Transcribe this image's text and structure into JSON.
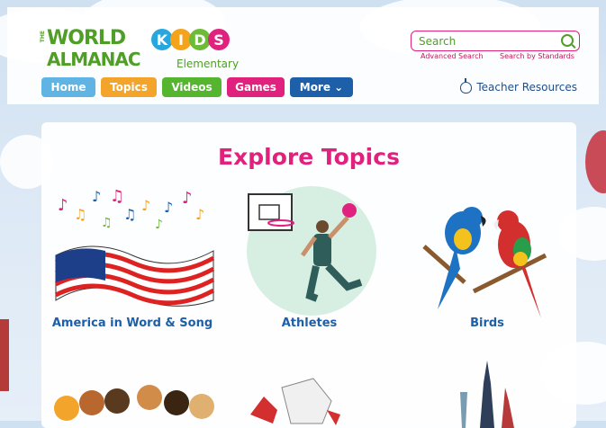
{
  "logo": {
    "the": "THE",
    "world": "WORLD",
    "almanac": "ALMANAC",
    "kids": [
      "K",
      "I",
      "D",
      "S"
    ],
    "kids_colors": [
      "#28a6de",
      "#f4a31d",
      "#6dbb38",
      "#e0217d"
    ],
    "elementary": "Elementary"
  },
  "search": {
    "placeholder": "Search",
    "advanced": "Advanced Search",
    "standards": "Search by Standards"
  },
  "nav": [
    {
      "label": "Home",
      "color": "#5fb4e4"
    },
    {
      "label": "Topics",
      "color": "#f2a52a"
    },
    {
      "label": "Videos",
      "color": "#55b52e"
    },
    {
      "label": "Games",
      "color": "#e0217d"
    },
    {
      "label": "More ⌄",
      "color": "#1d5fa8"
    }
  ],
  "teacher_resources": "Teacher Resources",
  "main": {
    "title": "Explore Topics",
    "topics": [
      {
        "label": "America in Word & Song",
        "icon": "us-flag-music-icon"
      },
      {
        "label": "Athletes",
        "icon": "basketball-player-icon"
      },
      {
        "label": "Birds",
        "icon": "parrots-icon"
      }
    ]
  },
  "colors": {
    "accent": "#e0217d",
    "link": "#1d5fa8",
    "brand_green": "#4f9e25"
  }
}
